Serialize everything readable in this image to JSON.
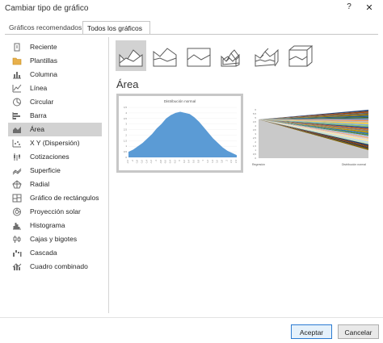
{
  "dialog": {
    "title": "Cambiar tipo de gráfico",
    "help": "?",
    "close": "✕"
  },
  "tabs": [
    {
      "label": "Gráficos recomendados",
      "selected": false
    },
    {
      "label": "Todos los gráficos",
      "selected": true
    }
  ],
  "sidebar": {
    "items": [
      {
        "label": "Reciente",
        "icon": "recent-icon"
      },
      {
        "label": "Plantillas",
        "icon": "folder-icon"
      },
      {
        "label": "Columna",
        "icon": "column-chart-icon"
      },
      {
        "label": "Línea",
        "icon": "line-chart-icon"
      },
      {
        "label": "Circular",
        "icon": "pie-chart-icon"
      },
      {
        "label": "Barra",
        "icon": "bar-chart-icon"
      },
      {
        "label": "Área",
        "icon": "area-chart-icon",
        "selected": true
      },
      {
        "label": "X Y (Dispersión)",
        "icon": "scatter-chart-icon"
      },
      {
        "label": "Cotizaciones",
        "icon": "stock-chart-icon"
      },
      {
        "label": "Superficie",
        "icon": "surface-chart-icon"
      },
      {
        "label": "Radial",
        "icon": "radar-chart-icon"
      },
      {
        "label": "Gráfico de rectángulos",
        "icon": "treemap-chart-icon"
      },
      {
        "label": "Proyección solar",
        "icon": "sunburst-chart-icon"
      },
      {
        "label": "Histograma",
        "icon": "histogram-chart-icon"
      },
      {
        "label": "Cajas y bigotes",
        "icon": "box-whisker-chart-icon"
      },
      {
        "label": "Cascada",
        "icon": "waterfall-chart-icon"
      },
      {
        "label": "Cuadro combinado",
        "icon": "combo-chart-icon"
      }
    ]
  },
  "subtypes": [
    {
      "icon": "area-icon",
      "selected": true
    },
    {
      "icon": "stacked-area-icon"
    },
    {
      "icon": "100-stacked-area-icon"
    },
    {
      "icon": "3d-area-icon"
    },
    {
      "icon": "3d-stacked-area-icon"
    },
    {
      "icon": "3d-100-stacked-area-icon"
    }
  ],
  "section_title": "Área",
  "previews": [
    {
      "title": "Distribución normal",
      "y_ticks": [
        "4,5",
        "4",
        "3,5",
        "3",
        "2,5",
        "2",
        "1,5",
        "1",
        "0,5",
        "0"
      ],
      "x_ticks": [
        "-2,2",
        "-2",
        "-1,8",
        "-1,6",
        "-1,4",
        "-1,2",
        "-1",
        "-0,8",
        "-0,6",
        "-0,4",
        "-0,2",
        "0",
        "0,2",
        "0,4",
        "0,6",
        "0,8",
        "1",
        "1,2",
        "1,4",
        "1,6",
        "1,8",
        "2",
        "2,2",
        "2,4"
      ],
      "fill": "#5b9bd5"
    },
    {
      "y_ticks": [
        "6",
        "5,5",
        "5",
        "4,5",
        "4",
        "3,5",
        "3",
        "2,5",
        "2",
        "1,5",
        "1",
        "0,5",
        "0"
      ],
      "x_first": "Regresión",
      "x_last": "Distribución normal"
    }
  ],
  "buttons": {
    "ok": "Aceptar",
    "cancel": "Cancelar"
  },
  "chart_data": [
    {
      "type": "area",
      "title": "Distribución normal",
      "x": [
        -2.2,
        -2,
        -1.8,
        -1.6,
        -1.4,
        -1.2,
        -1,
        -0.8,
        -0.6,
        -0.4,
        -0.2,
        0,
        0.2,
        0.4,
        0.6,
        0.8,
        1,
        1.2,
        1.4,
        1.6,
        1.8,
        2,
        2.2,
        2.4
      ],
      "series": [
        {
          "values": [
            0.5,
            0.7,
            1.0,
            1.3,
            1.7,
            2.1,
            2.6,
            3.0,
            3.5,
            3.8,
            4.0,
            4.1,
            4.0,
            3.9,
            3.6,
            3.2,
            2.7,
            2.2,
            1.7,
            1.3,
            0.9,
            0.6,
            0.4,
            0.2
          ]
        }
      ],
      "ylim": [
        0,
        4.5
      ]
    }
  ]
}
